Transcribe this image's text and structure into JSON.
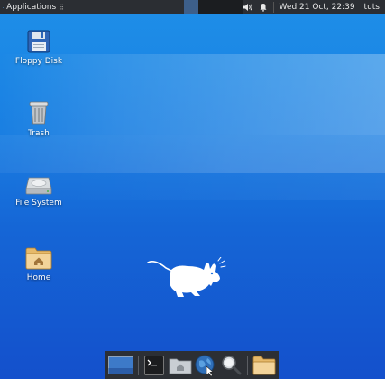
{
  "panel": {
    "app_menu_label": "Applications",
    "app_menu_separator": "⠿",
    "clock": "Wed 21 Oct, 22:39",
    "user": "tuts",
    "icons": [
      "xfce-logo-icon",
      "network-icon",
      "volume-icon",
      "notification-bell-icon"
    ]
  },
  "desktop": {
    "icons": [
      {
        "label": "Floppy Disk",
        "icon": "floppy-disk-icon"
      },
      {
        "label": "Trash",
        "icon": "trash-icon"
      },
      {
        "label": "File System",
        "icon": "hard-drive-icon"
      },
      {
        "label": "Home",
        "icon": "home-folder-icon"
      }
    ]
  },
  "dock": {
    "items": [
      "show-desktop-icon",
      "terminal-icon",
      "file-manager-icon",
      "web-browser-icon",
      "app-finder-icon",
      "folder-icon"
    ]
  },
  "colors": {
    "panel_bg": "#2b2e33",
    "desktop_top": "#1e8fe8",
    "desktop_bottom": "#1450cc"
  }
}
